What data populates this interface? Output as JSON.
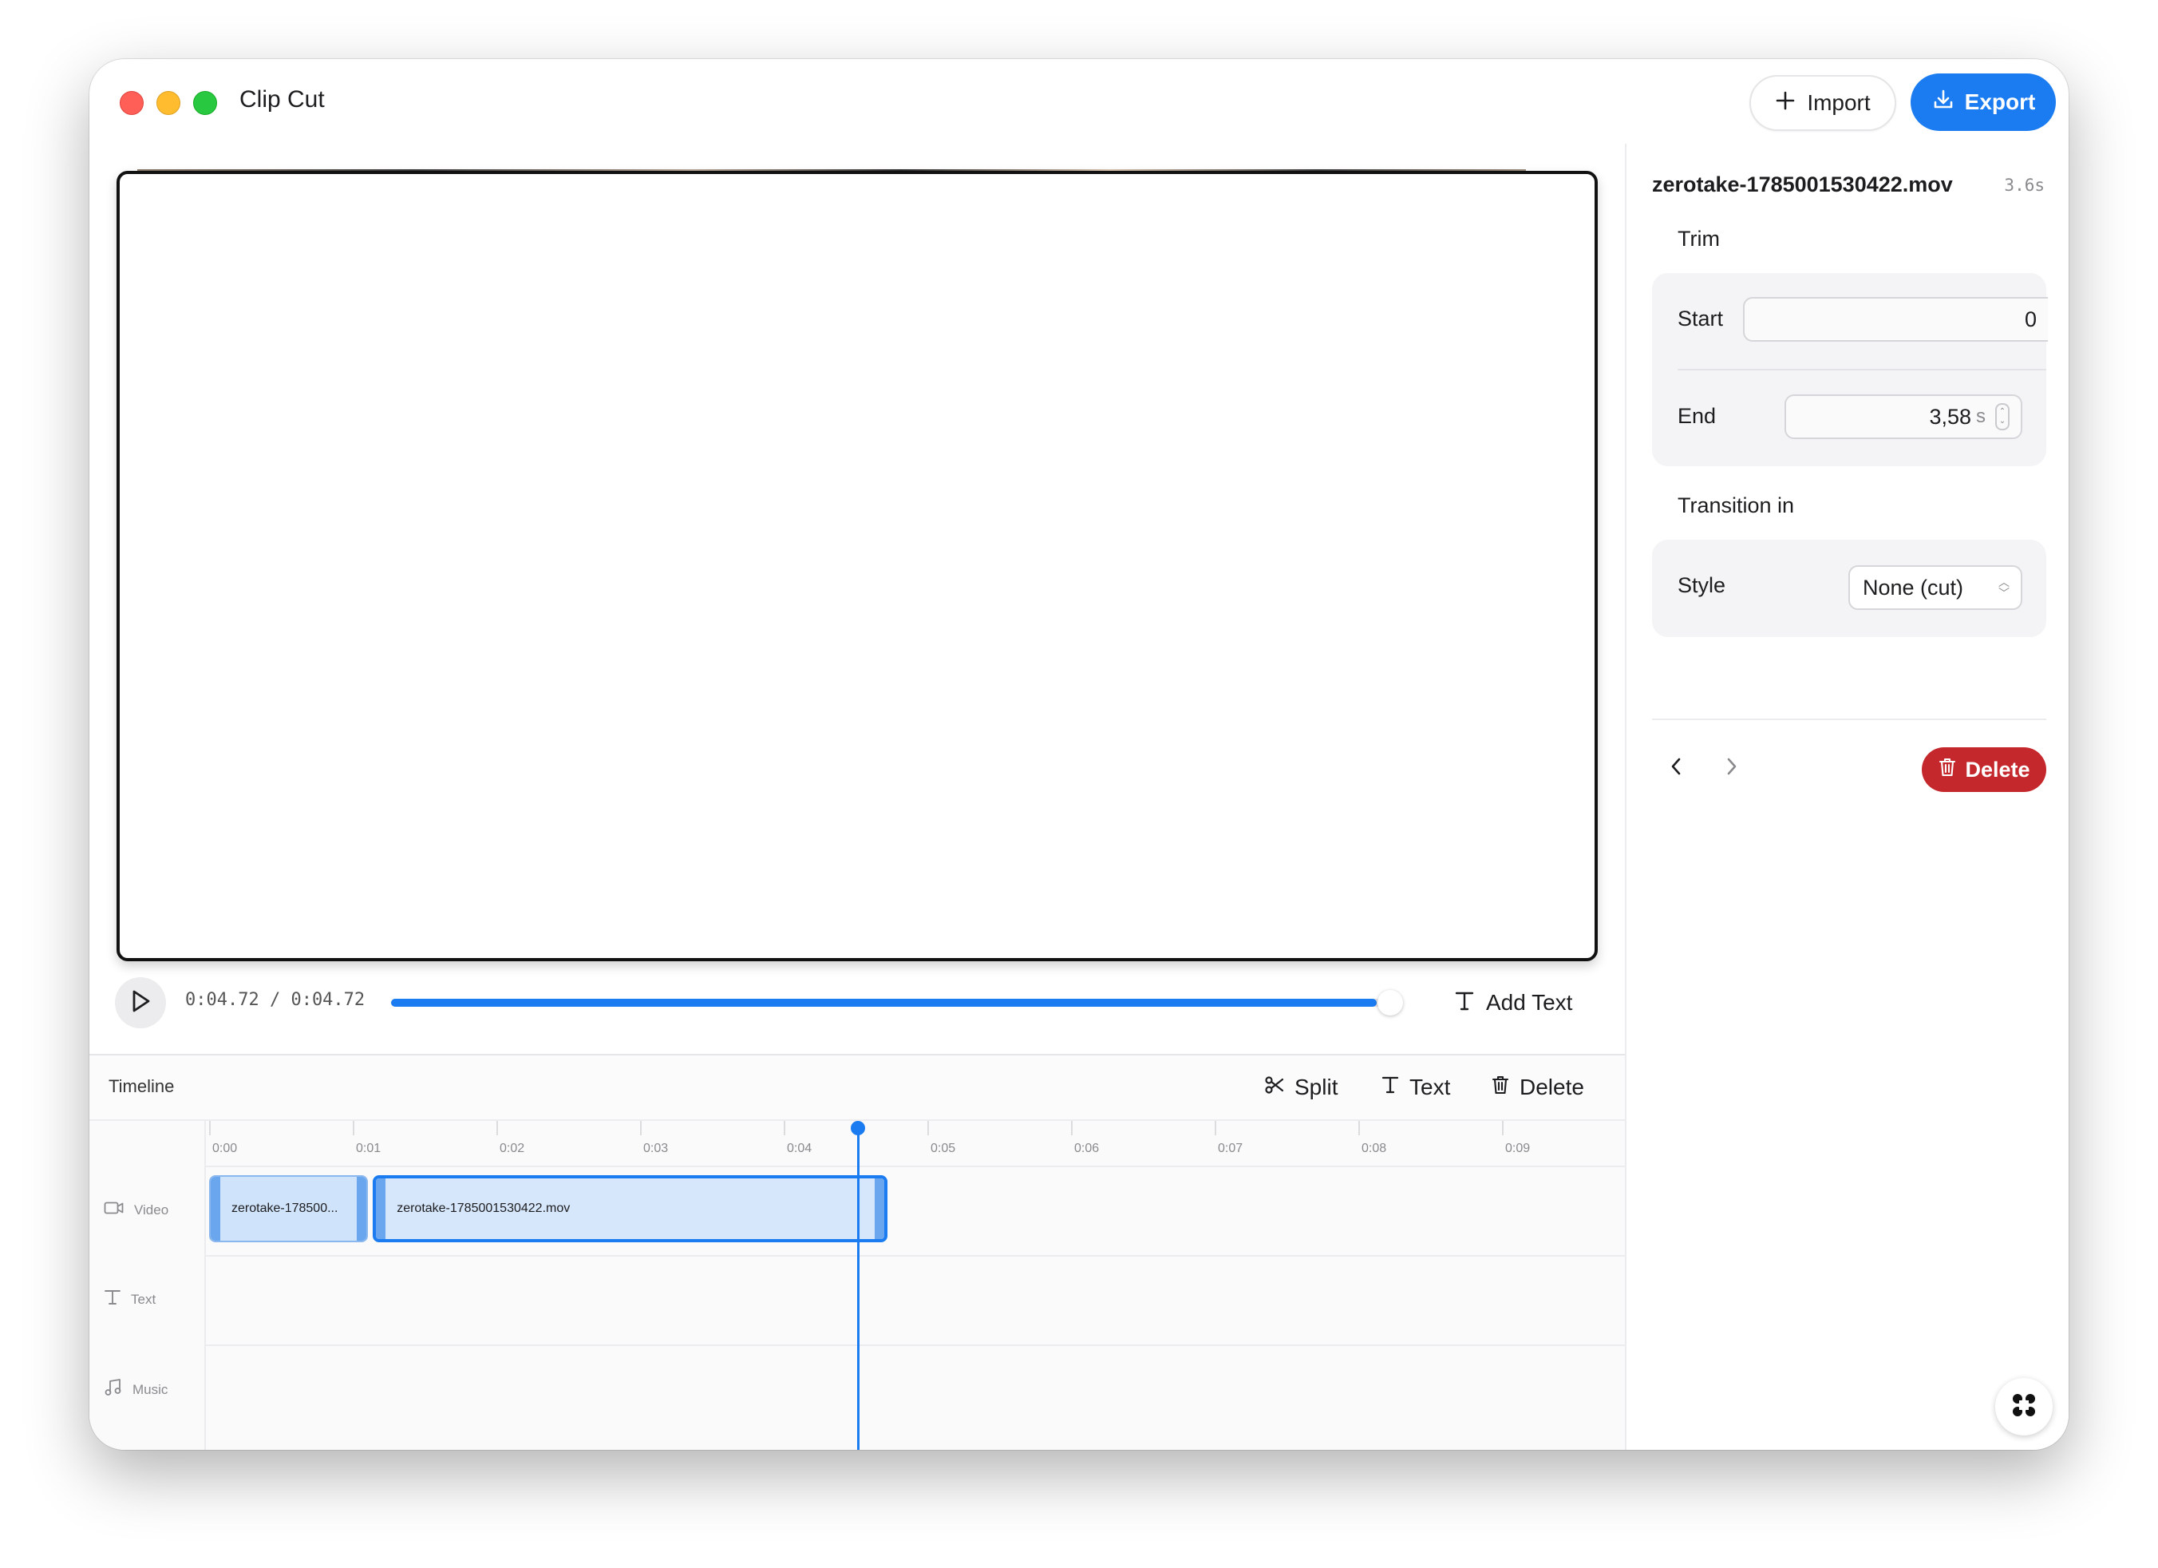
{
  "app": {
    "title": "Clip Cut"
  },
  "toolbar": {
    "import_label": "Import",
    "export_label": "Export"
  },
  "player": {
    "timecode": "0:04.72 / 0:04.72",
    "progress_fraction": 0.985,
    "add_text_label": "Add Text"
  },
  "timeline": {
    "title": "Timeline",
    "actions": {
      "split": "Split",
      "text": "Text",
      "delete": "Delete"
    },
    "ruler_ticks": [
      "0:00",
      "0:01",
      "0:02",
      "0:03",
      "0:04",
      "0:05",
      "0:06",
      "0:07",
      "0:08",
      "0:09"
    ],
    "tracks": {
      "video": "Video",
      "text": "Text",
      "music": "Music"
    },
    "clips": [
      {
        "label": "zerotake-178500...",
        "start_s": 0.0,
        "end_s": 1.14
      },
      {
        "label": "zerotake-1785001530422.mov",
        "start_s": 1.14,
        "end_s": 4.72,
        "selected": true
      }
    ],
    "playhead_s": 4.72
  },
  "inspector": {
    "file_name": "zerotake-1785001530422.mov",
    "duration": "3.6s",
    "trim": {
      "title": "Trim",
      "start_label": "Start",
      "start_value": "0",
      "end_label": "End",
      "end_value": "3,58",
      "end_unit": "s"
    },
    "transition": {
      "title": "Transition in",
      "style_label": "Style",
      "style_value": "None (cut)"
    },
    "delete_label": "Delete"
  },
  "colors": {
    "accent": "#1a7cf0",
    "danger": "#c5282c",
    "clip_fill": "#cfe3fb"
  }
}
